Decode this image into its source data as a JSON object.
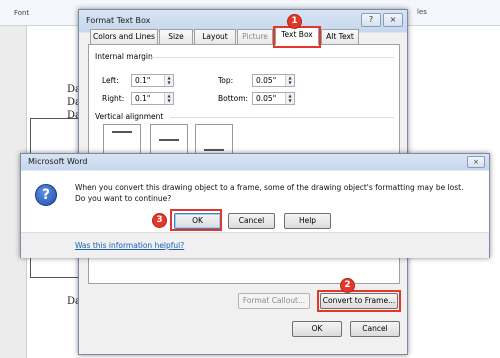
{
  "background_doc": {
    "ribbon_left_label": "Font",
    "ribbon_right_label": "les",
    "lines": [
      "DataNu",
      "DataNu",
      "DataNu",
      "DataNu"
    ]
  },
  "format_text_box": {
    "title": "Format Text Box",
    "help_glyph": "?",
    "close_glyph": "×",
    "tabs": [
      {
        "label": "Colors and Lines",
        "state": "normal"
      },
      {
        "label": "Size",
        "state": "normal"
      },
      {
        "label": "Layout",
        "state": "normal"
      },
      {
        "label": "Picture",
        "state": "disabled"
      },
      {
        "label": "Text Box",
        "state": "active"
      },
      {
        "label": "Alt Text",
        "state": "normal"
      }
    ],
    "internal_margin": {
      "heading": "Internal margin",
      "left": {
        "label": "Left:",
        "value": "0.1\""
      },
      "right": {
        "label": "Right:",
        "value": "0.1\""
      },
      "top": {
        "label": "Top:",
        "value": "0.05\""
      },
      "bottom": {
        "label": "Bottom:",
        "value": "0.05\""
      }
    },
    "vertical_alignment": {
      "heading": "Vertical alignment"
    },
    "format_callout_label": "Format Callout...",
    "convert_to_frame_label": "Convert to Frame...",
    "ok_label": "OK",
    "cancel_label": "Cancel"
  },
  "message_box": {
    "title": "Microsoft Word",
    "close_glyph": "×",
    "icon": "question-icon",
    "icon_glyph": "?",
    "message": "When you convert this drawing object to a frame, some of the drawing object's formatting may be lost. Do you want to continue?",
    "ok_label": "OK",
    "cancel_label": "Cancel",
    "help_label": "Help",
    "link_label": "Was this information helpful?"
  },
  "markers": {
    "step1": "1",
    "step2": "2",
    "step3": "3"
  },
  "colors": {
    "marker": "#e2372b",
    "link": "#1a5fb4",
    "title_gradient": "#c6d7ee"
  }
}
